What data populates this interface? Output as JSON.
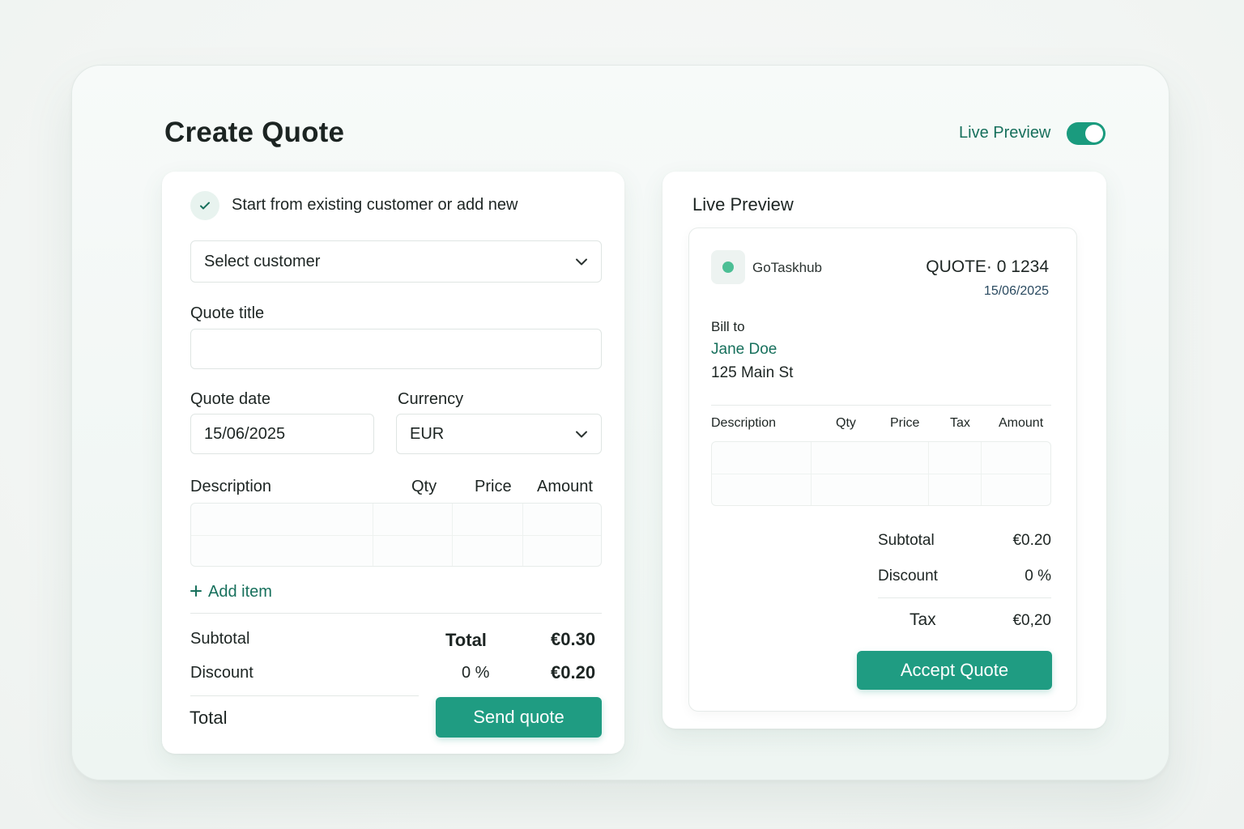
{
  "page": {
    "title": "Create Quote",
    "live_preview_toggle": {
      "label": "Live Preview",
      "on": true
    }
  },
  "form": {
    "intro": "Start from existing customer or add new",
    "customer_select": {
      "value": "Select customer"
    },
    "quote_title": {
      "label": "Quote title",
      "value": ""
    },
    "quote_date": {
      "label": "Quote date",
      "value": "15/06/2025"
    },
    "currency": {
      "label": "Currency",
      "value": "EUR"
    },
    "items_table": {
      "columns": [
        "Description",
        "Qty",
        "Price",
        "Amount"
      ]
    },
    "add_item_label": "Add item",
    "totals": {
      "subtotal_label": "Subtotal",
      "total_header": "Total",
      "total_header_value": "€0.30",
      "discount_label": "Discount",
      "discount_pct": "0 %",
      "discount_value": "€0.20",
      "total_label": "Total"
    },
    "send_button": "Send quote"
  },
  "preview": {
    "heading": "Live Preview",
    "brand": "GoTaskhub",
    "quote_number": "QUOTE· 0 1234",
    "quote_date": "15/06/2025",
    "bill_to_label": "Bill to",
    "customer_name": "Jane Doe",
    "customer_address": "125 Main St",
    "columns": [
      "Description",
      "Qty",
      "Price",
      "Tax",
      "Amount"
    ],
    "subtotal_label": "Subtotal",
    "subtotal_value": "€0.20",
    "discount_label": "Discount",
    "discount_value": "0 %",
    "tax_label": "Tax",
    "tax_value": "€0,20",
    "accept_button": "Accept Quote"
  },
  "colors": {
    "accent": "#1f9c82",
    "accent_text": "#17705c",
    "logo_dot": "#4cbf95"
  }
}
